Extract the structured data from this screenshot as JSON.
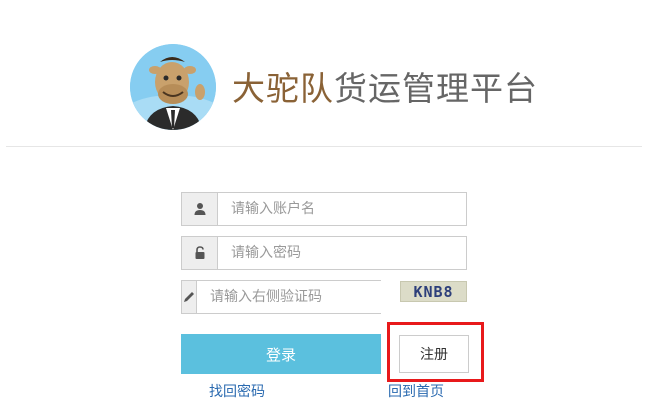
{
  "header": {
    "title_brand": "大驼队",
    "title_rest": "货运管理平台"
  },
  "form": {
    "username_placeholder": "请输入账户名",
    "password_placeholder": "请输入密码",
    "captcha_placeholder": "请输入右侧验证码",
    "captcha_text": "KNB8",
    "login_label": "登录",
    "register_label": "注册"
  },
  "links": {
    "forgot_password": "找回密码",
    "back_home": "回到首页"
  },
  "icons": {
    "username": "user-icon",
    "password": "lock-icon",
    "captcha": "pencil-icon"
  },
  "colors": {
    "brand": "#8a6236",
    "login_button": "#5bc0de",
    "highlight_frame": "#e8191b",
    "link": "#2a6ab0"
  }
}
